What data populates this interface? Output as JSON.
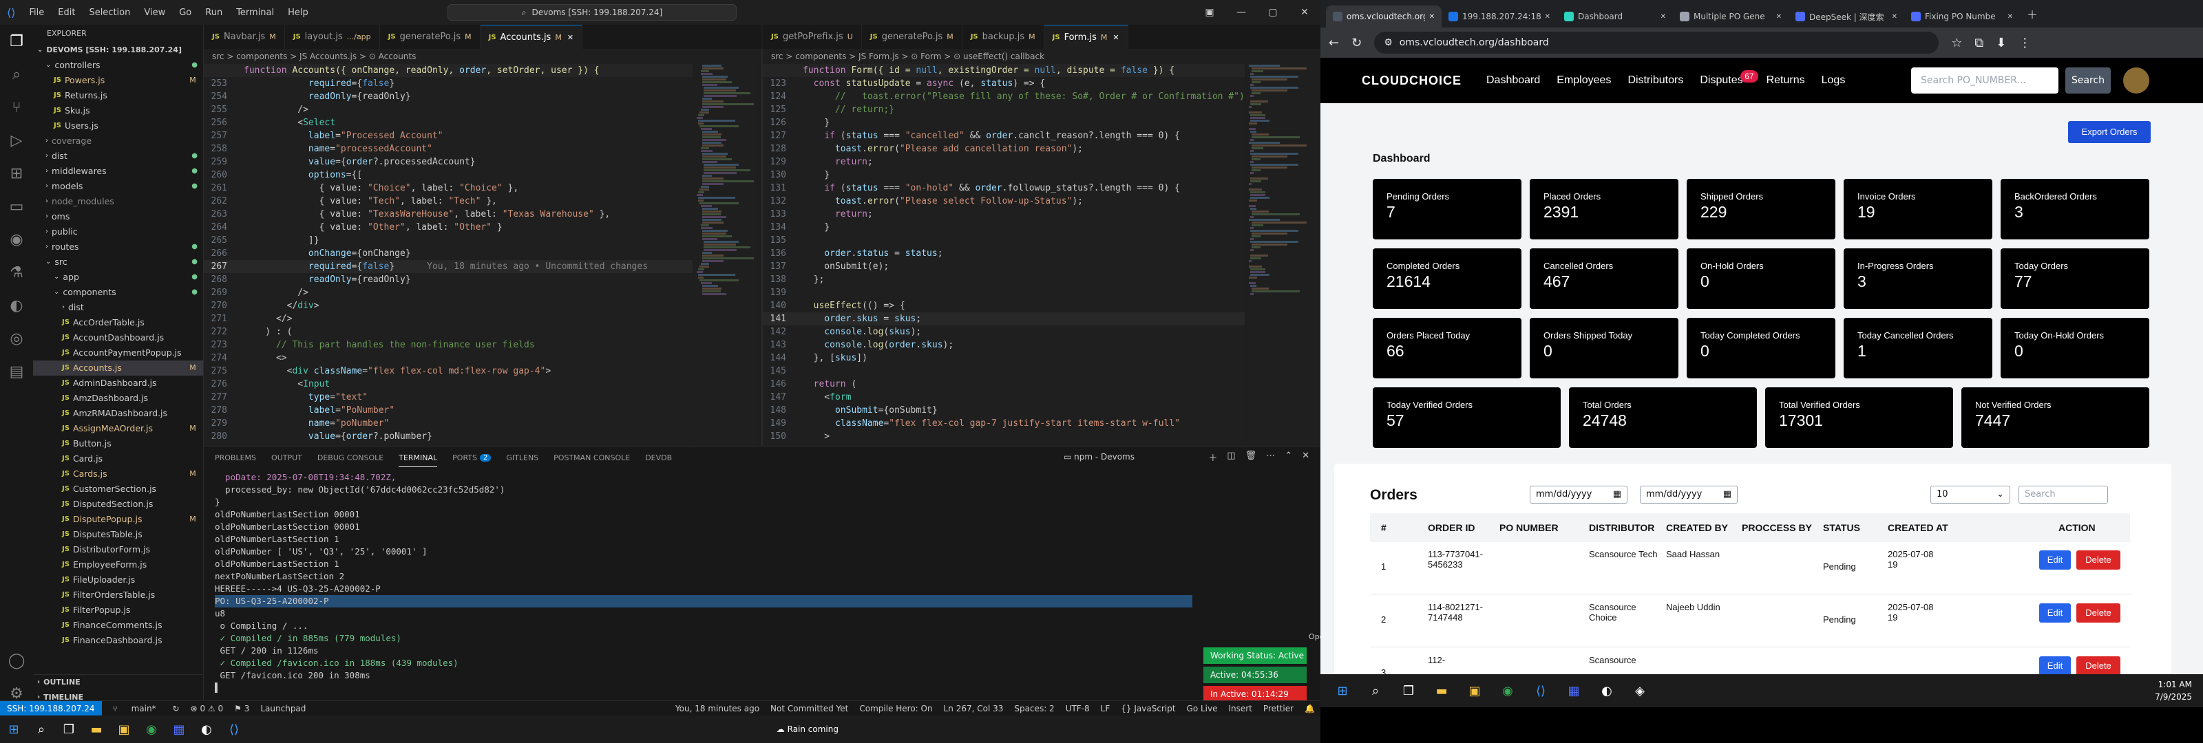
{
  "vscode": {
    "menu": [
      "File",
      "Edit",
      "Selection",
      "View",
      "Go",
      "Run",
      "Terminal",
      "Help"
    ],
    "command_center": "Devoms [SSH: 199.188.207.24]",
    "explorer_title": "EXPLORER",
    "workspace": "DEVOMS [SSH: 199.188.207.24]",
    "tree": [
      {
        "name": "controllers",
        "kind": "folder",
        "indent": 1,
        "dot": true
      },
      {
        "name": "Powers.js",
        "kind": "js",
        "indent": 2,
        "badge": "M"
      },
      {
        "name": "Returns.js",
        "kind": "js",
        "indent": 2
      },
      {
        "name": "Sku.js",
        "kind": "js",
        "indent": 2
      },
      {
        "name": "Users.js",
        "kind": "js",
        "indent": 2
      },
      {
        "name": "coverage",
        "kind": "folder",
        "indent": 1,
        "dim": true
      },
      {
        "name": "dist",
        "kind": "folder",
        "indent": 1,
        "dot": true
      },
      {
        "name": "middlewares",
        "kind": "folder",
        "indent": 1,
        "dot": true
      },
      {
        "name": "models",
        "kind": "folder",
        "indent": 1,
        "dot": true
      },
      {
        "name": "node_modules",
        "kind": "folder",
        "indent": 1,
        "dim": true
      },
      {
        "name": "oms",
        "kind": "folder",
        "indent": 1
      },
      {
        "name": "public",
        "kind": "folder",
        "indent": 1
      },
      {
        "name": "routes",
        "kind": "folder",
        "indent": 1,
        "dot": true
      },
      {
        "name": "src",
        "kind": "folder",
        "indent": 1,
        "dot": true
      },
      {
        "name": "app",
        "kind": "folder",
        "indent": 2,
        "dot": true
      },
      {
        "name": "components",
        "kind": "folder",
        "indent": 2,
        "dot": true
      },
      {
        "name": "dist",
        "kind": "folder",
        "indent": 3
      },
      {
        "name": "AccOrderTable.js",
        "kind": "js",
        "indent": 3
      },
      {
        "name": "AccountDashboard.js",
        "kind": "js",
        "indent": 3
      },
      {
        "name": "AccountPaymentPopup.js",
        "kind": "js",
        "indent": 3
      },
      {
        "name": "Accounts.js",
        "kind": "js",
        "indent": 3,
        "badge": "M",
        "selected": true
      },
      {
        "name": "AdminDashboard.js",
        "kind": "js",
        "indent": 3
      },
      {
        "name": "AmzDashboard.js",
        "kind": "js",
        "indent": 3
      },
      {
        "name": "AmzRMADashboard.js",
        "kind": "js",
        "indent": 3
      },
      {
        "name": "AssignMeAOrder.js",
        "kind": "js",
        "indent": 3,
        "badge": "M"
      },
      {
        "name": "Button.js",
        "kind": "js",
        "indent": 3
      },
      {
        "name": "Card.js",
        "kind": "js",
        "indent": 3
      },
      {
        "name": "Cards.js",
        "kind": "js",
        "indent": 3,
        "badge": "M"
      },
      {
        "name": "CustomerSection.js",
        "kind": "js",
        "indent": 3
      },
      {
        "name": "DisputedSection.js",
        "kind": "js",
        "indent": 3
      },
      {
        "name": "DisputePopup.js",
        "kind": "js",
        "indent": 3,
        "badge": "M"
      },
      {
        "name": "DisputesTable.js",
        "kind": "js",
        "indent": 3
      },
      {
        "name": "DistributorForm.js",
        "kind": "js",
        "indent": 3
      },
      {
        "name": "EmployeeForm.js",
        "kind": "js",
        "indent": 3
      },
      {
        "name": "FileUploader.js",
        "kind": "js",
        "indent": 3
      },
      {
        "name": "FilterOrdersTable.js",
        "kind": "js",
        "indent": 3
      },
      {
        "name": "FilterPopup.js",
        "kind": "js",
        "indent": 3
      },
      {
        "name": "FinanceComments.js",
        "kind": "js",
        "indent": 3
      },
      {
        "name": "FinanceDashboard.js",
        "kind": "js",
        "indent": 3
      }
    ],
    "outline": "OUTLINE",
    "timeline": "TIMELINE",
    "left_tabs": [
      {
        "label": "Navbar.js",
        "badge": "M"
      },
      {
        "label": "layout.js",
        "badge": ".../app"
      },
      {
        "label": "generatePo.js",
        "badge": "M"
      },
      {
        "label": "Accounts.js",
        "badge": "M",
        "active": true
      }
    ],
    "right_tabs": [
      {
        "label": "getPoPrefix.js",
        "badge": "U"
      },
      {
        "label": "generatePo.js",
        "badge": "M"
      },
      {
        "label": "backup.js",
        "badge": "M"
      },
      {
        "label": "Form.js",
        "badge": "M",
        "active": true
      }
    ],
    "left_breadcrumb": "src > components > JS Accounts.js > ⊙ Accounts",
    "right_breadcrumb": "src > components > JS Form.js > ⊙ Form > ⊙ useEffect() callback",
    "left_header": "function Accounts({ onChange, readOnly, order, setOrder, user }) {",
    "right_header": "function Form({ id = null, existingOrder = null, dispute = false }) {",
    "left_code": [
      {
        "n": "253",
        "t": "            required={false}"
      },
      {
        "n": "254",
        "t": "            readOnly={readOnly}"
      },
      {
        "n": "255",
        "t": "          />"
      },
      {
        "n": "256",
        "t": "          <Select"
      },
      {
        "n": "257",
        "t": "            label=\"Processed Account\""
      },
      {
        "n": "258",
        "t": "            name=\"processedAccount\""
      },
      {
        "n": "259",
        "t": "            value={order?.processedAccount}"
      },
      {
        "n": "260",
        "t": "            options={["
      },
      {
        "n": "261",
        "t": "              { value: \"Choice\", label: \"Choice\" },"
      },
      {
        "n": "262",
        "t": "              { value: \"Tech\", label: \"Tech\" },"
      },
      {
        "n": "263",
        "t": "              { value: \"TexasWareHouse\", label: \"Texas Warehouse\" },"
      },
      {
        "n": "264",
        "t": "              { value: \"Other\", label: \"Other\" }"
      },
      {
        "n": "265",
        "t": "            ]}"
      },
      {
        "n": "266",
        "t": "            onChange={onChange}"
      },
      {
        "n": "267",
        "t": "            required={false}      You, 18 minutes ago • Uncommitted changes",
        "cur": true
      },
      {
        "n": "268",
        "t": "            readOnly={readOnly}"
      },
      {
        "n": "269",
        "t": "          />"
      },
      {
        "n": "270",
        "t": "        </div>"
      },
      {
        "n": "271",
        "t": "      </>"
      },
      {
        "n": "272",
        "t": "    ) : ("
      },
      {
        "n": "273",
        "t": "      // This part handles the non-finance user fields"
      },
      {
        "n": "274",
        "t": "      <>"
      },
      {
        "n": "275",
        "t": "        <div className=\"flex flex-col md:flex-row gap-4\">"
      },
      {
        "n": "276",
        "t": "          <Input"
      },
      {
        "n": "277",
        "t": "            type=\"text\""
      },
      {
        "n": "278",
        "t": "            label=\"PoNumber\""
      },
      {
        "n": "279",
        "t": "            name=\"poNumber\""
      },
      {
        "n": "280",
        "t": "            value={order?.poNumber}"
      }
    ],
    "right_code": [
      {
        "n": "123",
        "t": "  const statusUpdate = async (e, status) => {"
      },
      {
        "n": "124",
        "t": "      //   toast.error(\"Please fill any of these: So#, Order # or Confirmation #\")"
      },
      {
        "n": "125",
        "t": "      // return;}"
      },
      {
        "n": "126",
        "t": "    }"
      },
      {
        "n": "127",
        "t": "    if (status === \"cancelled\" && order.canclt_reason?.length === 0) {"
      },
      {
        "n": "128",
        "t": "      toast.error(\"Please add cancellation reason\");"
      },
      {
        "n": "129",
        "t": "      return;"
      },
      {
        "n": "130",
        "t": "    }"
      },
      {
        "n": "131",
        "t": "    if (status === \"on-hold\" && order.followup_status?.length === 0) {"
      },
      {
        "n": "132",
        "t": "      toast.error(\"Please select Follow-up-Status\");"
      },
      {
        "n": "133",
        "t": "      return;"
      },
      {
        "n": "134",
        "t": "    }"
      },
      {
        "n": "135",
        "t": ""
      },
      {
        "n": "136",
        "t": "    order.status = status;"
      },
      {
        "n": "137",
        "t": "    onSubmit(e);"
      },
      {
        "n": "138",
        "t": "  };"
      },
      {
        "n": "139",
        "t": ""
      },
      {
        "n": "140",
        "t": "  useEffect(() => {"
      },
      {
        "n": "141",
        "t": "    order.skus = skus;",
        "cur": true
      },
      {
        "n": "142",
        "t": "    console.log(skus);"
      },
      {
        "n": "143",
        "t": "    console.log(order.skus);"
      },
      {
        "n": "144",
        "t": "  }, [skus])"
      },
      {
        "n": "145",
        "t": ""
      },
      {
        "n": "146",
        "t": "  return ("
      },
      {
        "n": "147",
        "t": "    <form"
      },
      {
        "n": "148",
        "t": "      onSubmit={onSubmit}"
      },
      {
        "n": "149",
        "t": "      className=\"flex flex-col gap-7 justify-start items-start w-full\""
      },
      {
        "n": "150",
        "t": "    >"
      }
    ],
    "panel_tabs": [
      "PROBLEMS",
      "OUTPUT",
      "DEBUG CONSOLE",
      "TERMINAL",
      "PORTS",
      "GITLENS",
      "POSTMAN CONSOLE",
      "DEVDB"
    ],
    "ports_count": "2",
    "terminal_name": "npm - Devoms",
    "terminal_lines": [
      "  poDate: 2025-07-08T19:34:48.702Z,",
      "  processed_by: new ObjectId('67ddc4d0062cc23fc52d5d82')",
      "}",
      "oldPoNumberLastSection 00001",
      "oldPoNumberLastSection 00001",
      "oldPoNumberLastSection 1",
      "oldPoNumber [ 'US', 'Q3', '25', '00001' ]",
      "oldPoNumberLastSection 1",
      "nextPoNumberLastSection 2",
      "HEREEE----->4 US-Q3-25-A200002-P",
      "PO: US-Q3-25-A200002-P",
      "u8",
      " o Compiling / ...",
      " ✓ Compiled / in 885ms (779 modules)",
      " GET / 200 in 1126ms",
      " ✓ Compiled /favicon.ico in 188ms (439 modules)",
      " GET /favicon.ico 200 in 308ms",
      "▌"
    ],
    "open_app": "Open App ↗",
    "work_status": "Working Status: Active",
    "active_time": "Active: 04:55:36",
    "inactive_time": "In Active: 01:14:29",
    "status": {
      "remote": "SSH: 199.188.207.24",
      "branch": "main*",
      "sync": "↻",
      "errors": "⊗ 0  ⚠ 0",
      "ports": "⚑ 3",
      "launchpad": "Launchpad",
      "blame": "You, 18 minutes ago",
      "commit": "Not Committed Yet",
      "compile": "Compile Hero: On",
      "pos": "Ln 267, Col 33",
      "spaces": "Spaces: 2",
      "enc": "UTF-8",
      "eol": "LF",
      "lang": "{} JavaScript",
      "golive": "Go Live",
      "insert": "Insert",
      "prettier": "Prettier"
    },
    "weather": "Rain coming"
  },
  "chrome": {
    "tabs": [
      {
        "label": "oms.vcloudtech.org",
        "active": true,
        "color": "#4b5563"
      },
      {
        "label": "199.188.207.24:18",
        "color": "#1a73e8"
      },
      {
        "label": "Dashboard",
        "color": "#2dd4bf"
      },
      {
        "label": "Multiple PO Gene",
        "color": "#9ca3af"
      },
      {
        "label": "DeepSeek | 深度索",
        "color": "#4d6bfe"
      },
      {
        "label": "Fixing PO Numbe",
        "color": "#4d6bfe"
      }
    ],
    "url": "oms.vcloudtech.org/dashboard",
    "nav": {
      "logo": "CLOUDCHOICE",
      "links": [
        "Dashboard",
        "Employees",
        "Distributors",
        "Disputes",
        "Returns",
        "Logs"
      ],
      "dispute_badge": "67",
      "search_placeholder": "Search PO_NUMBER...",
      "search_btn": "Search"
    },
    "dashboard_title": "Dashboard",
    "export_btn": "Export Orders",
    "cards": [
      {
        "label": "Pending Orders",
        "value": "7"
      },
      {
        "label": "Placed Orders",
        "value": "2391"
      },
      {
        "label": "Shipped Orders",
        "value": "229"
      },
      {
        "label": "Invoice Orders",
        "value": "19"
      },
      {
        "label": "BackOrdered Orders",
        "value": "3"
      },
      {
        "label": "Completed Orders",
        "value": "21614"
      },
      {
        "label": "Cancelled Orders",
        "value": "467"
      },
      {
        "label": "On-Hold Orders",
        "value": "0"
      },
      {
        "label": "In-Progress Orders",
        "value": "3"
      },
      {
        "label": "Today Orders",
        "value": "77"
      },
      {
        "label": "Orders Placed Today",
        "value": "66"
      },
      {
        "label": "Orders Shipped Today",
        "value": "0"
      },
      {
        "label": "Today Completed Orders",
        "value": "0"
      },
      {
        "label": "Today Cancelled Orders",
        "value": "1"
      },
      {
        "label": "Today On-Hold Orders",
        "value": "0"
      },
      {
        "label": "Today Verified Orders",
        "value": "57"
      },
      {
        "label": "Total Orders",
        "value": "24748"
      },
      {
        "label": "Total Verified Orders",
        "value": "17301"
      },
      {
        "label": "Not Verified Orders",
        "value": "7447"
      }
    ],
    "orders": {
      "title": "Orders",
      "date1": "mm/dd/yyyy",
      "date2": "mm/dd/yyyy",
      "page_size": "10",
      "search_placeholder": "Search",
      "headers": [
        "#",
        "ORDER ID",
        "PO NUMBER",
        "DISTRIBUTOR",
        "CREATED BY",
        "PROCCESS BY",
        "STATUS",
        "CREATED AT",
        "ACTION"
      ],
      "rows": [
        {
          "idx": "1",
          "order_id": "113-7737041-5456233",
          "po": "",
          "distributor": "Scansource Tech",
          "created_by": "Saad Hassan",
          "process_by": "",
          "status": "Pending",
          "created_at": "2025-07-08 19"
        },
        {
          "idx": "2",
          "order_id": "114-8021271-7147448",
          "po": "",
          "distributor": "Scansource Choice",
          "created_by": "Najeeb Uddin",
          "process_by": "",
          "status": "Pending",
          "created_at": "2025-07-08 19"
        },
        {
          "idx": "3",
          "order_id": "112-",
          "po": "",
          "distributor": "Scansource",
          "created_by": "",
          "process_by": "",
          "status": "",
          "created_at": ""
        }
      ],
      "edit": "Edit",
      "delete": "Delete"
    }
  },
  "taskbar": {
    "time": "1:01 AM",
    "date": "7/9/2025"
  }
}
